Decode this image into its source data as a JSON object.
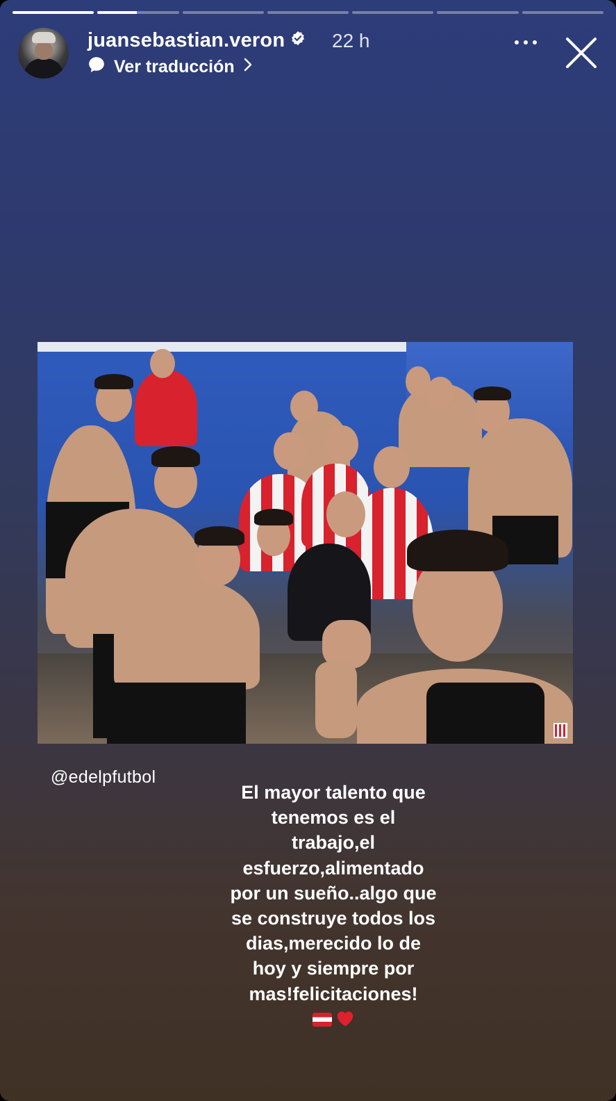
{
  "story": {
    "progress": [
      1,
      0.48,
      0,
      0,
      0,
      0,
      0
    ],
    "progress_color": "#ffffff"
  },
  "header": {
    "username": "juansebastian.veron",
    "time": "22 h",
    "translate_label": "Ver traducción",
    "verified_color": "#ffffff"
  },
  "post": {
    "mention": "@edelpfutbol",
    "caption": "El mayor talento que\ntenemos es el\ntrabajo,el\nesfuerzo,alimentado\npor un sueño..algo que\nse construye todos los\ndias,merecido lo de\nhoy y siempre por\nmas!felicitaciones!",
    "heart": "❤️"
  },
  "colors": {
    "accent_red": "#d8222d",
    "gradient_top": "#2d3d7a",
    "gradient_bottom": "#3f3124"
  }
}
